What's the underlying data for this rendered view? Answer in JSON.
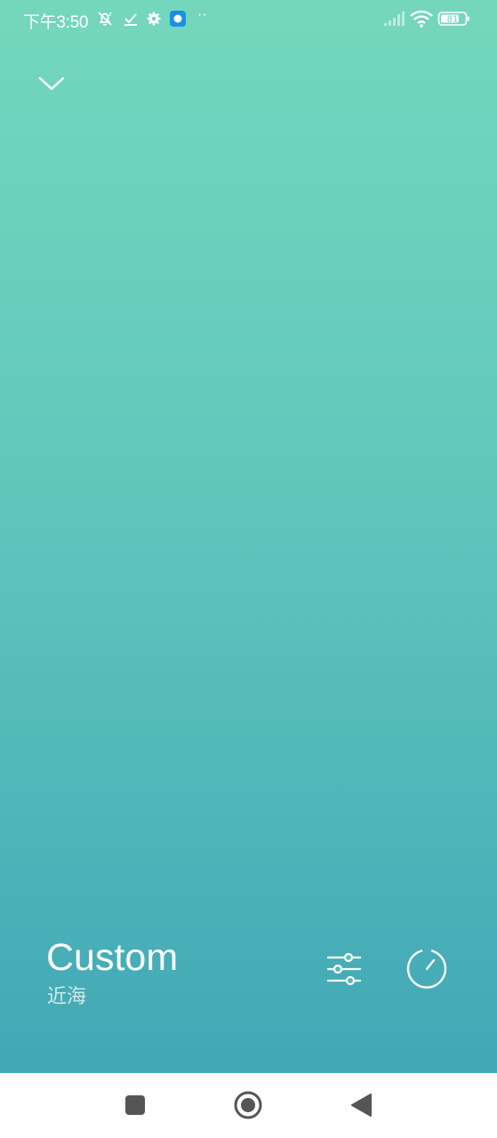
{
  "status_bar": {
    "time": "下午3:50",
    "battery_level": "81",
    "more_indicator": "··",
    "icons": [
      "alarm-off-icon",
      "checkmark-icon",
      "settings-gear-icon",
      "app-notification-icon",
      "more-dots-icon",
      "signal-icon",
      "wifi-icon",
      "battery-icon"
    ]
  },
  "header": {
    "collapse_icon": "chevron-down-icon"
  },
  "scene": {
    "title": "Custom",
    "subtitle": "近海"
  },
  "controls": {
    "adjust_icon": "sliders-icon",
    "timer_icon": "timer-icon"
  },
  "navigation": {
    "items": [
      "recents-square-icon",
      "home-circle-icon",
      "back-triangle-icon"
    ]
  },
  "colors": {
    "gradient_top": "#74d7bd",
    "gradient_bottom": "#41a7b5",
    "foreground": "#ffffff",
    "nav_icon": "#555555"
  }
}
